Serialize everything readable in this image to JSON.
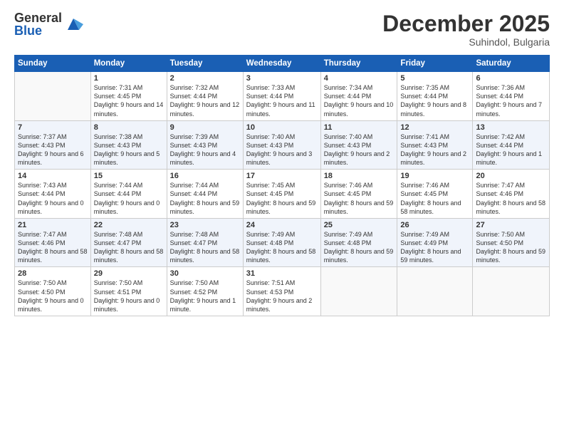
{
  "logo": {
    "general": "General",
    "blue": "Blue"
  },
  "title": "December 2025",
  "subtitle": "Suhindol, Bulgaria",
  "days": [
    "Sunday",
    "Monday",
    "Tuesday",
    "Wednesday",
    "Thursday",
    "Friday",
    "Saturday"
  ],
  "weeks": [
    [
      {
        "num": "",
        "sunrise": "",
        "sunset": "",
        "daylight": ""
      },
      {
        "num": "1",
        "sunrise": "Sunrise: 7:31 AM",
        "sunset": "Sunset: 4:45 PM",
        "daylight": "Daylight: 9 hours and 14 minutes."
      },
      {
        "num": "2",
        "sunrise": "Sunrise: 7:32 AM",
        "sunset": "Sunset: 4:44 PM",
        "daylight": "Daylight: 9 hours and 12 minutes."
      },
      {
        "num": "3",
        "sunrise": "Sunrise: 7:33 AM",
        "sunset": "Sunset: 4:44 PM",
        "daylight": "Daylight: 9 hours and 11 minutes."
      },
      {
        "num": "4",
        "sunrise": "Sunrise: 7:34 AM",
        "sunset": "Sunset: 4:44 PM",
        "daylight": "Daylight: 9 hours and 10 minutes."
      },
      {
        "num": "5",
        "sunrise": "Sunrise: 7:35 AM",
        "sunset": "Sunset: 4:44 PM",
        "daylight": "Daylight: 9 hours and 8 minutes."
      },
      {
        "num": "6",
        "sunrise": "Sunrise: 7:36 AM",
        "sunset": "Sunset: 4:44 PM",
        "daylight": "Daylight: 9 hours and 7 minutes."
      }
    ],
    [
      {
        "num": "7",
        "sunrise": "Sunrise: 7:37 AM",
        "sunset": "Sunset: 4:43 PM",
        "daylight": "Daylight: 9 hours and 6 minutes."
      },
      {
        "num": "8",
        "sunrise": "Sunrise: 7:38 AM",
        "sunset": "Sunset: 4:43 PM",
        "daylight": "Daylight: 9 hours and 5 minutes."
      },
      {
        "num": "9",
        "sunrise": "Sunrise: 7:39 AM",
        "sunset": "Sunset: 4:43 PM",
        "daylight": "Daylight: 9 hours and 4 minutes."
      },
      {
        "num": "10",
        "sunrise": "Sunrise: 7:40 AM",
        "sunset": "Sunset: 4:43 PM",
        "daylight": "Daylight: 9 hours and 3 minutes."
      },
      {
        "num": "11",
        "sunrise": "Sunrise: 7:40 AM",
        "sunset": "Sunset: 4:43 PM",
        "daylight": "Daylight: 9 hours and 2 minutes."
      },
      {
        "num": "12",
        "sunrise": "Sunrise: 7:41 AM",
        "sunset": "Sunset: 4:43 PM",
        "daylight": "Daylight: 9 hours and 2 minutes."
      },
      {
        "num": "13",
        "sunrise": "Sunrise: 7:42 AM",
        "sunset": "Sunset: 4:44 PM",
        "daylight": "Daylight: 9 hours and 1 minute."
      }
    ],
    [
      {
        "num": "14",
        "sunrise": "Sunrise: 7:43 AM",
        "sunset": "Sunset: 4:44 PM",
        "daylight": "Daylight: 9 hours and 0 minutes."
      },
      {
        "num": "15",
        "sunrise": "Sunrise: 7:44 AM",
        "sunset": "Sunset: 4:44 PM",
        "daylight": "Daylight: 9 hours and 0 minutes."
      },
      {
        "num": "16",
        "sunrise": "Sunrise: 7:44 AM",
        "sunset": "Sunset: 4:44 PM",
        "daylight": "Daylight: 8 hours and 59 minutes."
      },
      {
        "num": "17",
        "sunrise": "Sunrise: 7:45 AM",
        "sunset": "Sunset: 4:45 PM",
        "daylight": "Daylight: 8 hours and 59 minutes."
      },
      {
        "num": "18",
        "sunrise": "Sunrise: 7:46 AM",
        "sunset": "Sunset: 4:45 PM",
        "daylight": "Daylight: 8 hours and 59 minutes."
      },
      {
        "num": "19",
        "sunrise": "Sunrise: 7:46 AM",
        "sunset": "Sunset: 4:45 PM",
        "daylight": "Daylight: 8 hours and 58 minutes."
      },
      {
        "num": "20",
        "sunrise": "Sunrise: 7:47 AM",
        "sunset": "Sunset: 4:46 PM",
        "daylight": "Daylight: 8 hours and 58 minutes."
      }
    ],
    [
      {
        "num": "21",
        "sunrise": "Sunrise: 7:47 AM",
        "sunset": "Sunset: 4:46 PM",
        "daylight": "Daylight: 8 hours and 58 minutes."
      },
      {
        "num": "22",
        "sunrise": "Sunrise: 7:48 AM",
        "sunset": "Sunset: 4:47 PM",
        "daylight": "Daylight: 8 hours and 58 minutes."
      },
      {
        "num": "23",
        "sunrise": "Sunrise: 7:48 AM",
        "sunset": "Sunset: 4:47 PM",
        "daylight": "Daylight: 8 hours and 58 minutes."
      },
      {
        "num": "24",
        "sunrise": "Sunrise: 7:49 AM",
        "sunset": "Sunset: 4:48 PM",
        "daylight": "Daylight: 8 hours and 58 minutes."
      },
      {
        "num": "25",
        "sunrise": "Sunrise: 7:49 AM",
        "sunset": "Sunset: 4:48 PM",
        "daylight": "Daylight: 8 hours and 59 minutes."
      },
      {
        "num": "26",
        "sunrise": "Sunrise: 7:49 AM",
        "sunset": "Sunset: 4:49 PM",
        "daylight": "Daylight: 8 hours and 59 minutes."
      },
      {
        "num": "27",
        "sunrise": "Sunrise: 7:50 AM",
        "sunset": "Sunset: 4:50 PM",
        "daylight": "Daylight: 8 hours and 59 minutes."
      }
    ],
    [
      {
        "num": "28",
        "sunrise": "Sunrise: 7:50 AM",
        "sunset": "Sunset: 4:50 PM",
        "daylight": "Daylight: 9 hours and 0 minutes."
      },
      {
        "num": "29",
        "sunrise": "Sunrise: 7:50 AM",
        "sunset": "Sunset: 4:51 PM",
        "daylight": "Daylight: 9 hours and 0 minutes."
      },
      {
        "num": "30",
        "sunrise": "Sunrise: 7:50 AM",
        "sunset": "Sunset: 4:52 PM",
        "daylight": "Daylight: 9 hours and 1 minute."
      },
      {
        "num": "31",
        "sunrise": "Sunrise: 7:51 AM",
        "sunset": "Sunset: 4:53 PM",
        "daylight": "Daylight: 9 hours and 2 minutes."
      },
      {
        "num": "",
        "sunrise": "",
        "sunset": "",
        "daylight": ""
      },
      {
        "num": "",
        "sunrise": "",
        "sunset": "",
        "daylight": ""
      },
      {
        "num": "",
        "sunrise": "",
        "sunset": "",
        "daylight": ""
      }
    ]
  ]
}
